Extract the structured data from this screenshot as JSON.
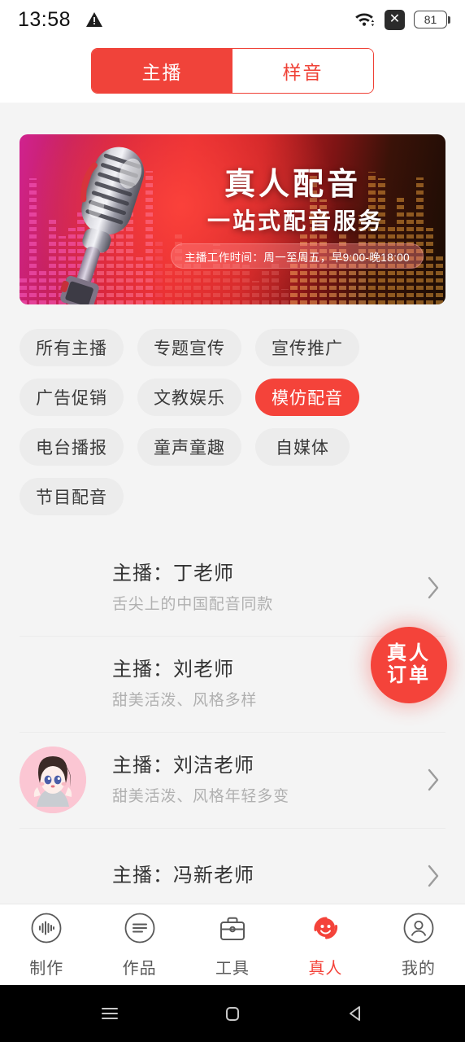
{
  "status_bar": {
    "time": "13:58",
    "warning_icon": "warning-triangle-icon",
    "wifi_icon": "wifi-icon",
    "no_sim_icon": "no-sim-icon",
    "no_sim_glyph": "✕",
    "battery_level": "81"
  },
  "tabs": {
    "items": [
      {
        "label": "主播",
        "active": true
      },
      {
        "label": "样音",
        "active": false
      }
    ],
    "active_color": "#f0433a"
  },
  "banner": {
    "title": "真人配音",
    "subtitle": "一站式配音服务",
    "badge": "主播工作时间：周一至周五，早9:00-晚18:00",
    "image": "vintage-microphone"
  },
  "categories": [
    {
      "label": "所有主播",
      "active": false
    },
    {
      "label": "专题宣传",
      "active": false
    },
    {
      "label": "宣传推广",
      "active": false
    },
    {
      "label": "广告促销",
      "active": false
    },
    {
      "label": "文教娱乐",
      "active": false
    },
    {
      "label": "模仿配音",
      "active": true
    },
    {
      "label": "电台播报",
      "active": false
    },
    {
      "label": "童声童趣",
      "active": false
    },
    {
      "label": "自媒体",
      "active": false
    },
    {
      "label": "节目配音",
      "active": false
    }
  ],
  "anchors": [
    {
      "title": "主播：丁老师",
      "subtitle": "舌尖上的中国配音同款",
      "has_avatar": false
    },
    {
      "title": "主播：刘老师",
      "subtitle": "甜美活泼、风格多样",
      "has_avatar": false
    },
    {
      "title": "主播：刘洁老师",
      "subtitle": "甜美活泼、风格年轻多变",
      "has_avatar": true
    },
    {
      "title": "主播：冯新老师",
      "subtitle": "",
      "has_avatar": false
    }
  ],
  "fab": {
    "line1": "真人",
    "line2": "订单",
    "color": "#f4433a"
  },
  "bottom_nav": [
    {
      "label": "制作",
      "icon": "waveform-circle-icon",
      "active": false
    },
    {
      "label": "作品",
      "icon": "lines-circle-icon",
      "active": false
    },
    {
      "label": "工具",
      "icon": "toolbox-icon",
      "active": false
    },
    {
      "label": "真人",
      "icon": "headset-face-icon",
      "active": true
    },
    {
      "label": "我的",
      "icon": "person-circle-icon",
      "active": false
    }
  ],
  "android_nav": [
    {
      "icon": "recents-icon"
    },
    {
      "icon": "home-icon"
    },
    {
      "icon": "back-icon"
    }
  ]
}
